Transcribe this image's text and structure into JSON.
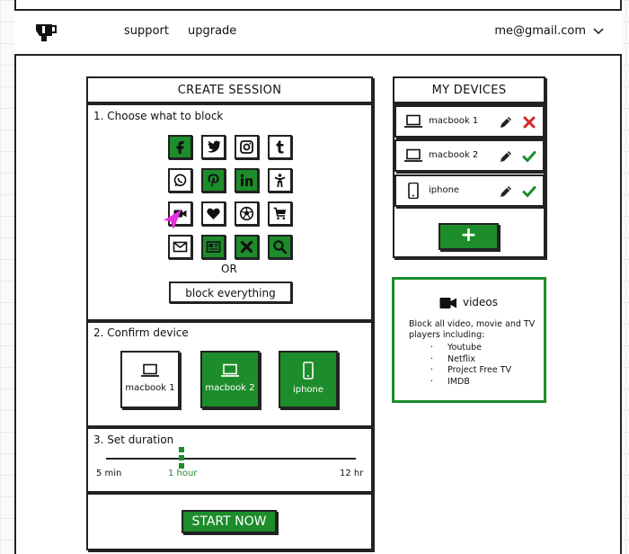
{
  "header": {
    "nav": [
      {
        "label": "support"
      },
      {
        "label": "upgrade"
      }
    ],
    "user_email": "me@gmail.com"
  },
  "create_session": {
    "title": "CREATE SESSION",
    "step1": {
      "label": "1. Choose what to block",
      "tiles": [
        {
          "icon": "facebook-icon",
          "selected": true
        },
        {
          "icon": "twitter-icon",
          "selected": false
        },
        {
          "icon": "instagram-icon",
          "selected": false
        },
        {
          "icon": "tumblr-icon",
          "selected": false
        },
        {
          "icon": "whatsapp-icon",
          "selected": false
        },
        {
          "icon": "pinterest-icon",
          "selected": true
        },
        {
          "icon": "linkedin-icon",
          "selected": true
        },
        {
          "icon": "dating-icon",
          "selected": false
        },
        {
          "icon": "video-camera-icon",
          "selected": false
        },
        {
          "icon": "heart-icon",
          "selected": false
        },
        {
          "icon": "soccer-ball-icon",
          "selected": false
        },
        {
          "icon": "shopping-cart-icon",
          "selected": false
        },
        {
          "icon": "mail-icon",
          "selected": false
        },
        {
          "icon": "news-icon",
          "selected": true
        },
        {
          "icon": "block-custom-icon",
          "selected": true
        },
        {
          "icon": "search-icon",
          "selected": true
        }
      ],
      "or_label": "OR",
      "block_everything_label": "block everything"
    },
    "step2": {
      "label": "2. Confirm device",
      "devices": [
        {
          "name": "macbook 1",
          "type": "laptop",
          "selected": false
        },
        {
          "name": "macbook 2",
          "type": "laptop",
          "selected": true
        },
        {
          "name": "iphone",
          "type": "phone",
          "selected": true
        }
      ]
    },
    "step3": {
      "label": "3. Set duration",
      "min_label": "5 min",
      "value_label": "1 hour",
      "max_label": "12 hr"
    },
    "start_label": "START NOW"
  },
  "my_devices": {
    "title": "MY DEVICES",
    "devices": [
      {
        "name": "macbook 1",
        "type": "laptop",
        "status": "blocked"
      },
      {
        "name": "macbook 2",
        "type": "laptop",
        "status": "active"
      },
      {
        "name": "iphone",
        "type": "phone",
        "status": "active"
      }
    ],
    "add_label": "+"
  },
  "info": {
    "title": "videos",
    "description": "Block all video, movie and TV players including:",
    "items": [
      "Youtube",
      "Netflix",
      "Project Free TV",
      "IMDB"
    ]
  },
  "colors": {
    "accent": "#1d8c2a",
    "danger": "#d6262a",
    "cursor": "#e62de0"
  }
}
